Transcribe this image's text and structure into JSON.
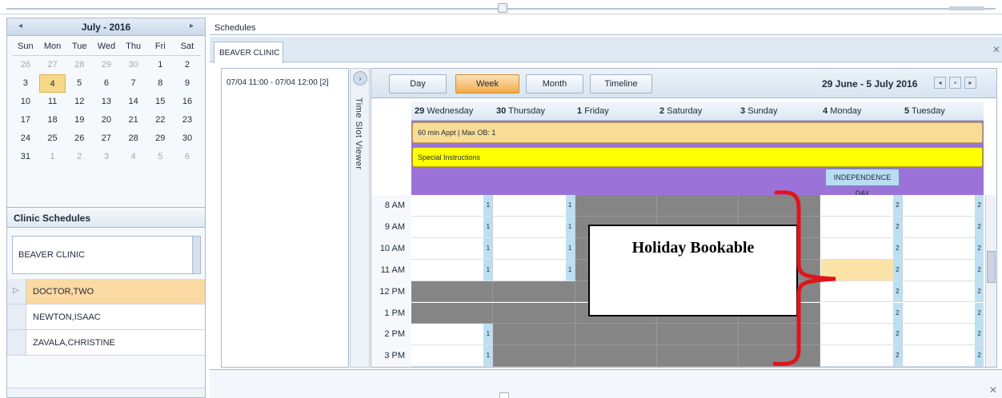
{
  "calendar": {
    "month_label": "July - 2016",
    "prev_icon": "chevron-left",
    "next_icon": "chevron-right",
    "weekdays": [
      "Sun",
      "Mon",
      "Tue",
      "Wed",
      "Thu",
      "Fri",
      "Sat"
    ],
    "weeks": [
      [
        "26",
        "27",
        "28",
        "29",
        "30",
        "1",
        "2"
      ],
      [
        "3",
        "4",
        "5",
        "6",
        "7",
        "8",
        "9"
      ],
      [
        "10",
        "11",
        "12",
        "13",
        "14",
        "15",
        "16"
      ],
      [
        "17",
        "18",
        "19",
        "20",
        "21",
        "22",
        "23"
      ],
      [
        "24",
        "25",
        "26",
        "27",
        "28",
        "29",
        "30"
      ],
      [
        "31",
        "1",
        "2",
        "3",
        "4",
        "5",
        "6"
      ]
    ],
    "today": "4"
  },
  "clinic_schedules": {
    "heading": "Clinic Schedules",
    "selected_clinic": "BEAVER CLINIC",
    "providers": [
      "DOCTOR,TWO",
      "NEWTON,ISAAC",
      "ZAVALA,CHRISTINE"
    ],
    "selected_provider": "DOCTOR,TWO"
  },
  "schedules": {
    "header": "Schedules",
    "tab_label": "BEAVER CLINIC",
    "close_icon": "x",
    "slot_item": "07/04 11:00 - 07/04 12:00  [2]",
    "slot_viewer_label": "Time Slot Viewer",
    "view_buttons": [
      "Day",
      "Week",
      "Month",
      "Timeline"
    ],
    "active_view": "Week",
    "date_range": "29 June - 5 July 2016",
    "nav_icons": [
      "prev",
      "today",
      "next"
    ],
    "days": [
      {
        "num": "29",
        "name": "Wednesday"
      },
      {
        "num": "30",
        "name": "Thursday"
      },
      {
        "num": "1",
        "name": "Friday"
      },
      {
        "num": "2",
        "name": "Saturday"
      },
      {
        "num": "3",
        "name": "Sunday"
      },
      {
        "num": "4",
        "name": "Monday"
      },
      {
        "num": "5",
        "name": "Tuesday"
      }
    ],
    "appt_banner": "60 min Appt | Max OB: 1",
    "special_banner": "Special Instructions",
    "holiday_badge": "INDEPENDENCE DAY",
    "times": [
      "8 AM",
      "9 AM",
      "10 AM",
      "11 AM",
      "12 PM",
      "1 PM",
      "2 PM",
      "3 PM"
    ],
    "slot_count_a": "1",
    "slot_count_b": "2"
  },
  "annotation": {
    "callout_text": "Holiday Bookable",
    "brace_color": "#e0141b"
  },
  "colors": {
    "purple": "#9b73d8",
    "gray_block": "#858585",
    "active_orange": "#f2a94a",
    "highlight": "#fbe3a8"
  }
}
